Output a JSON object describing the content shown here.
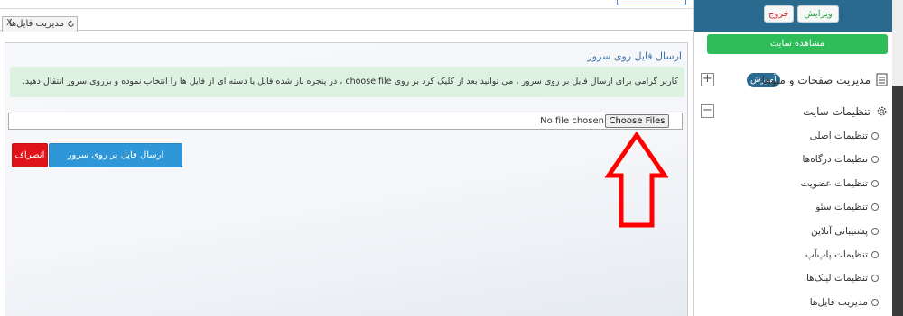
{
  "tab": {
    "label": "مدیریت فایل‌ها",
    "close": "X"
  },
  "panel": {
    "title": "ارسال فایل روی سرور",
    "info": "کاربر گرامی برای ارسال فایل بر روی سرور ، می توانید بعد از کلیک کرد بر روی choose file ، در پنجره باز شده فایل یا دسته ای از فایل ها را انتخاب نموده و برروی سرور انتقال دهید.",
    "choose_files": "Choose Files",
    "no_file": "No file chosen",
    "send_button": "ارسال فایل بر روی سرور",
    "cancel_button": "انصراف"
  },
  "sidebar": {
    "edit": "ویرایش",
    "exit": "خروج",
    "view_site": "مشاهده سایت",
    "section_pages": {
      "label": "مدیریت صفحات و منوها",
      "badge": "آموزش",
      "toggle": "+"
    },
    "section_settings": {
      "label": "تنظیمات سایت",
      "toggle": "−"
    },
    "items": [
      "تنظیمات اصلی",
      "تنظیمات درگاه‌ها",
      "تنظیمات عضویت",
      "تنظیمات سئو",
      "پشتیبانی آنلاین",
      "تنظیمات پاپ‌آپ",
      "تنظیمات لینک‌ها",
      "مدیریت فایل‌ها"
    ]
  },
  "colors": {
    "accent_blue": "#2f97d8",
    "danger": "#e1131a",
    "success": "#2ebd59",
    "header": "#2a6a8f",
    "annotation_arrow": "#ff0000"
  }
}
